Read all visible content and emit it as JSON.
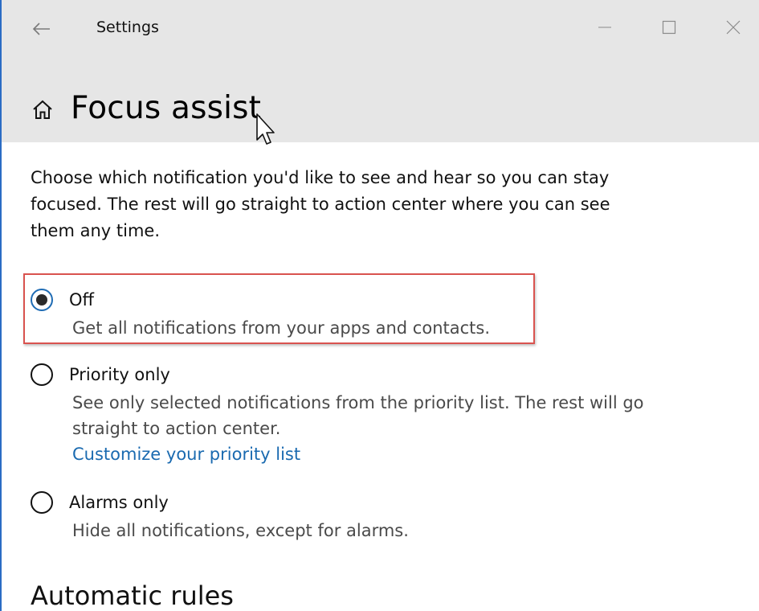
{
  "window": {
    "app_title": "Settings",
    "accent_color": "#2b6cc4"
  },
  "header": {
    "page_title": "Focus assist"
  },
  "intro": "Choose which notification you'd like to see and hear so you can stay focused. The rest will go straight to action center where you can see them any time.",
  "options": [
    {
      "label": "Off",
      "description": "Get all notifications from your apps and contacts.",
      "checked": true
    },
    {
      "label": "Priority only",
      "description": "See only selected notifications from the priority list. The rest will go straight to action center.",
      "link": "Customize your priority list",
      "checked": false
    },
    {
      "label": "Alarms only",
      "description": "Hide all notifications, except for alarms.",
      "checked": false
    }
  ],
  "section_heading": "Automatic rules",
  "colors": {
    "header_bg": "#e6e6e6",
    "link": "#1a6ab0",
    "highlight_border": "#d9534f"
  },
  "icons": [
    "back-arrow-icon",
    "minimize-icon",
    "maximize-icon",
    "close-icon",
    "home-icon",
    "mouse-pointer-icon"
  ]
}
